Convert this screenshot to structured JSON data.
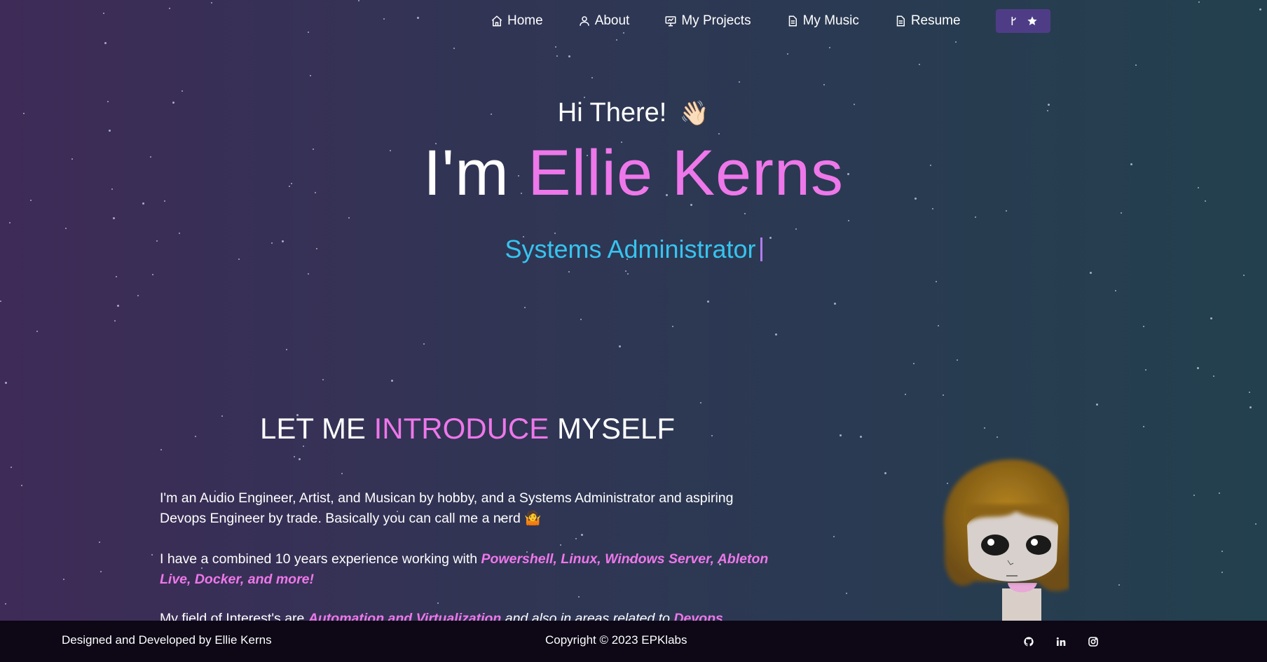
{
  "nav": {
    "items": [
      {
        "label": "Home",
        "icon": "home-icon"
      },
      {
        "label": "About",
        "icon": "user-icon"
      },
      {
        "label": "My Projects",
        "icon": "presentation-icon"
      },
      {
        "label": "My Music",
        "icon": "document-icon"
      },
      {
        "label": "Resume",
        "icon": "document-icon"
      }
    ],
    "repo_button_icons": [
      "git-fork-icon",
      "star-icon"
    ]
  },
  "hero": {
    "greeting": "Hi There!",
    "wave": "👋🏻",
    "name_prefix": "I'm",
    "name": "Ellie Kerns",
    "role": "Systems Administrator"
  },
  "intro": {
    "title_part1": "LET ME",
    "title_highlight": "INTRODUCE",
    "title_part2": "MYSELF",
    "p1": "I'm an Audio Engineer, Artist, and Musican by hobby, and a Systems Administrator and aspiring Devops Engineer by trade. Basically you can call me a nerd",
    "p1_emoji": "🤷",
    "p2_text": "I have a combined 10 years experience working with",
    "p2_highlight": "Powershell, Linux, Windows Server, Ableton Live, Docker, and more!",
    "p3_text": "My field of Interest's are",
    "p3_highlight1": "Automation and Virtualization",
    "p3_mid": "and also in areas related to",
    "p3_highlight2": "Devops"
  },
  "footer": {
    "left": "Designed and Developed by Ellie Kerns",
    "center": "Copyright © 2023 EPKlabs",
    "icons": [
      "github-icon",
      "linkedin-icon",
      "instagram-icon"
    ]
  },
  "colors": {
    "accent_pink": "#ee77ea",
    "accent_blue": "#36c4ef",
    "button_purple": "#4e3d86",
    "footer_bg": "#0d0716"
  }
}
